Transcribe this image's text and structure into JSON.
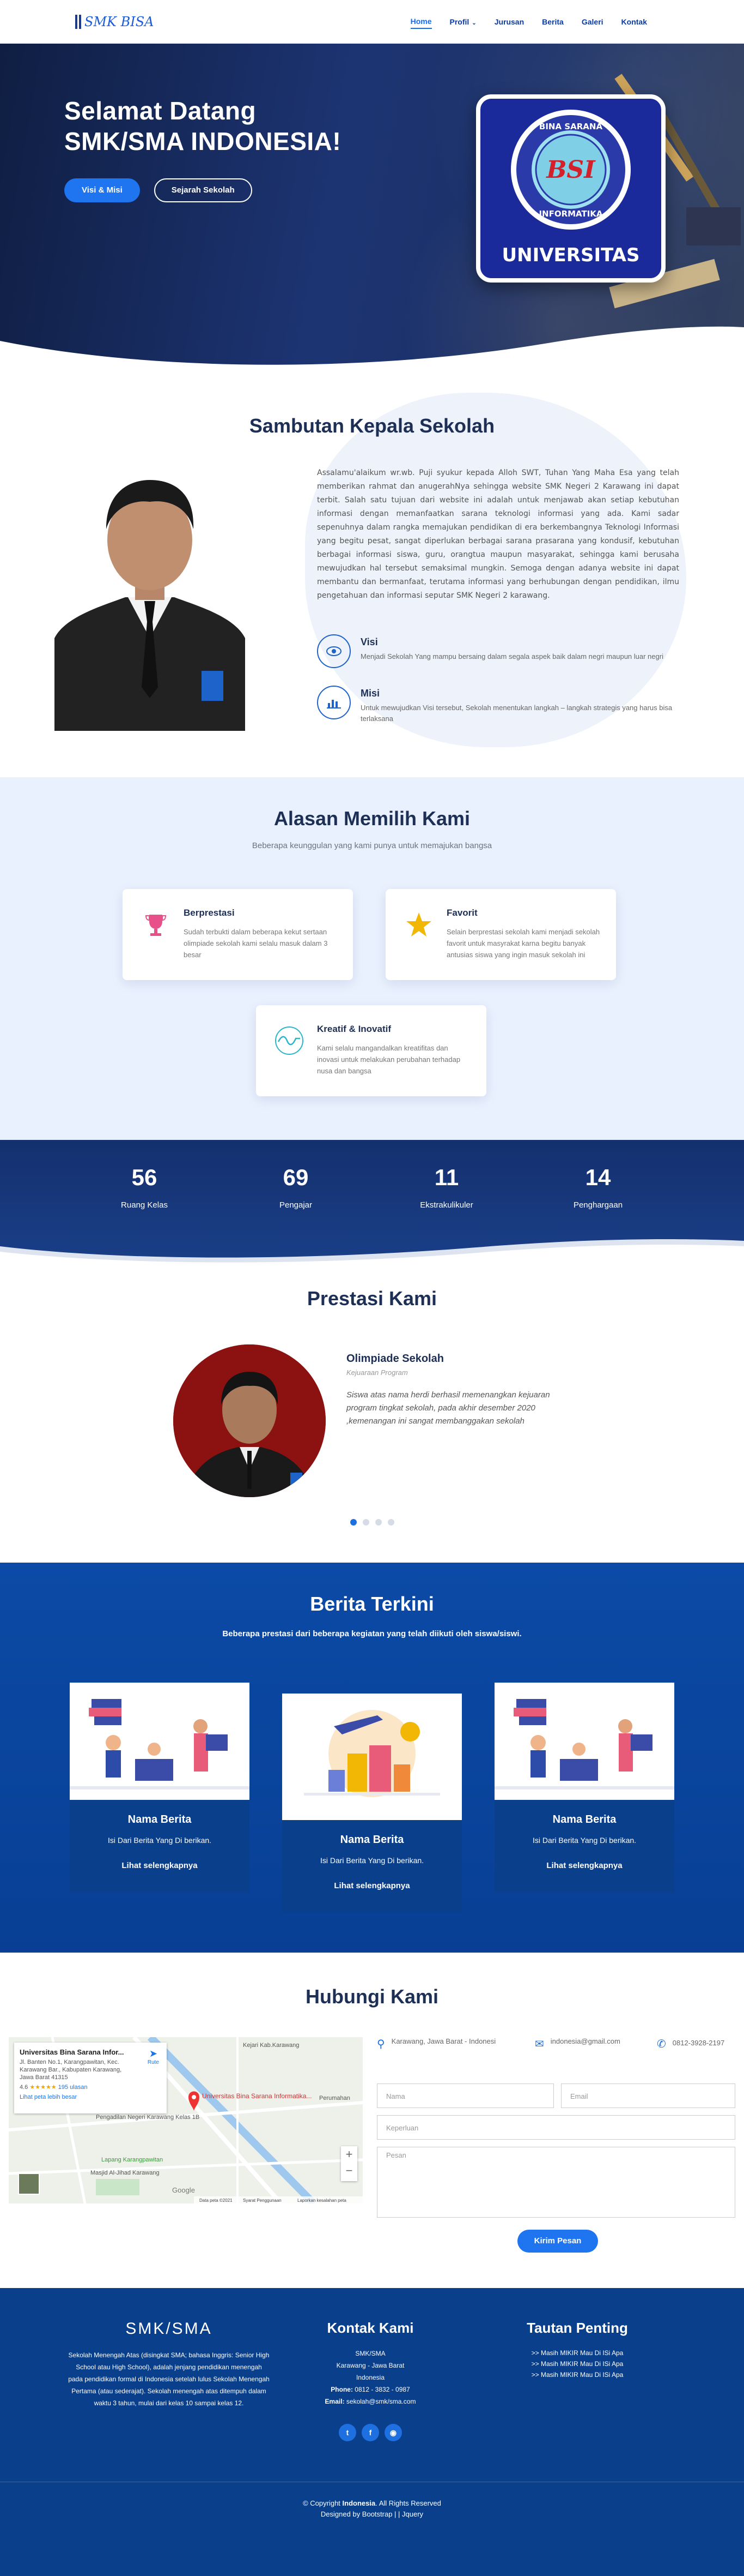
{
  "brand": {
    "logo_text": "SMK BISA"
  },
  "nav": {
    "home": "Home",
    "profil": "Profil",
    "jurusan": "Jurusan",
    "berita": "Berita",
    "galeri": "Galeri",
    "kontak": "Kontak"
  },
  "hero": {
    "title_line1": "Selamat Datang",
    "title_line2": "SMK/SMA INDONESIA!",
    "btn_primary": "Visi & Misi",
    "btn_secondary": "Sejarah Sekolah",
    "badge_top": "BINA SARANA",
    "badge_mid": "BSI",
    "badge_bottom": "INFORMATIKA",
    "badge_label": "UNIVERSITAS"
  },
  "sambutan": {
    "title": "Sambutan Kepala Sekolah",
    "text": "Assalamu'alaikum wr.wb. Puji syukur kepada Alloh SWT, Tuhan Yang Maha Esa yang telah memberikan rahmat dan anugerahNya sehingga website SMK Negeri 2 Karawang ini dapat terbit. Salah satu tujuan dari website ini adalah untuk menjawab akan setiap kebutuhan informasi dengan memanfaatkan sarana teknologi informasi yang ada. Kami sadar sepenuhnya dalam rangka memajukan pendidikan di era berkembangnya Teknologi Informasi yang begitu pesat, sangat diperlukan berbagai sarana prasarana yang kondusif, kebutuhan berbagai informasi siswa, guru, orangtua maupun masyarakat, sehingga kami berusaha mewujudkan hal tersebut semaksimal mungkin. Semoga dengan adanya website ini dapat membantu dan bermanfaat, terutama informasi yang berhubungan dengan pendidikan, ilmu pengetahuan dan informasi seputar SMK Negeri 2 karawang.",
    "visi_title": "Visi",
    "visi_text": "Menjadi Sekolah Yang mampu bersaing dalam segala aspek baik dalam negri maupun luar negri",
    "misi_title": "Misi",
    "misi_text": "Untuk mewujudkan Visi tersebut, Sekolah menentukan langkah – langkah strategis yang harus bisa terlaksana"
  },
  "alasan": {
    "title": "Alasan Memilih Kami",
    "subtitle": "Beberapa keunggulan yang kami punya untuk memajukan bangsa",
    "cards": [
      {
        "title": "Berprestasi",
        "text": "Sudah terbukti dalam beberapa kekut sertaan olimpiade sekolah kami selalu masuk dalam 3 besar",
        "icon": "trophy-icon",
        "color": "#e8508a"
      },
      {
        "title": "Favorit",
        "text": "Selain berprestasi sekolah kami menjadi sekolah favorit untuk masyrakat karna begitu banyak antusias siswa yang ingin masuk sekolah ini",
        "icon": "star-icon",
        "color": "#f2b705"
      },
      {
        "title": "Kreatif & Inovatif",
        "text": "Kami selalu mangandalkan kreatifitas dan inovasi untuk melakukan perubahan terhadap nusa dan bangsa",
        "icon": "pulse-icon",
        "color": "#2bb5c8"
      }
    ]
  },
  "stats": [
    {
      "num": "56",
      "label": "Ruang Kelas"
    },
    {
      "num": "69",
      "label": "Pengajar"
    },
    {
      "num": "11",
      "label": "Ekstrakulikuler"
    },
    {
      "num": "14",
      "label": "Penghargaan"
    }
  ],
  "prestasi": {
    "title": "Prestasi Kami",
    "name": "Olimpiade Sekolah",
    "sub": "Kejuaraan Program",
    "text": "Siswa atas nama herdi berhasil memenangkan kejuaran program tingkat sekolah, pada akhir desember 2020 ,kemenangan ini sangat membanggakan sekolah"
  },
  "berita": {
    "title": "Berita Terkini",
    "subtitle": "Beberapa prestasi dari beberapa kegiatan yang telah diikuti oleh siswa/siswi.",
    "items": [
      {
        "title": "Nama Berita",
        "text": "Isi Dari Berita Yang Di berikan.",
        "link": "Lihat selengkapnya"
      },
      {
        "title": "Nama Berita",
        "text": "Isi Dari Berita Yang Di berikan.",
        "link": "Lihat selengkapnya"
      },
      {
        "title": "Nama Berita",
        "text": "Isi Dari Berita Yang Di berikan.",
        "link": "Lihat selengkapnya"
      }
    ]
  },
  "hubungi": {
    "title": "Hubungi Kami",
    "address": "Karawang, Jawa Barat - Indonesi",
    "email": "indonesia@gmail.com",
    "phone": "0812-3928-2197",
    "map": {
      "place_title": "Universitas Bina Sarana Infor...",
      "place_addr": "Jl. Banten No.1, Karangpawitan, Kec. Karawang Bar., Kabupaten Karawang, Jawa Barat 41315",
      "rating": "4.6",
      "reviews": "195 ulasan",
      "bigger": "Lihat peta lebih besar",
      "route": "Rute",
      "pin_label": "Universitas Bina Sarana Informatika...",
      "l1": "Pengadilan Negeri Karawang Kelas 1B",
      "l2": "Lapang Karangpawitan",
      "l3": "Masjid Al-Jihad Karawang",
      "l4": "Perumahan",
      "l5": "Kejari Kab.Karawang",
      "footer_data": "Data peta ©2021",
      "footer_terms": "Syarat Penggunaan",
      "footer_report": "Laporkan kesalahan peta",
      "google": "Google"
    },
    "ph_nama": "Nama",
    "ph_email": "Email",
    "ph_keperluan": "Keperluan",
    "ph_pesan": "Pesan",
    "btn": "Kirim Pesan"
  },
  "footer": {
    "brand": "SMK/SMA",
    "about": "Sekolah Menengah Atas (disingkat SMA; bahasa Inggris: Senior High School atau High School), adalah jenjang pendidikan menengah pada pendidikan formal di Indonesia setelah lulus Sekolah Menengah Pertama (atau sederajat). Sekolah menengah atas ditempuh dalam waktu 3 tahun, mulai dari kelas 10 sampai kelas 12.",
    "contact_title": "Kontak Kami",
    "c1": "SMK/SMA",
    "c2": "Karawang - Jawa Barat",
    "c3": "Indonesia",
    "phone_label": "Phone:",
    "phone": "0812 - 3832 - 0987",
    "email_label": "Email:",
    "email": "sekolah@smk/sma.com",
    "links_title": "Tautan Penting",
    "links": [
      ">> Masih MIKIR Mau Di ISi Apa",
      ">> Masih MIKIR Mau Di ISi Apa",
      ">> Masih MIKIR Mau Di ISi Apa"
    ],
    "copy_pre": "© Copyright ",
    "copy_brand": "Indonesia",
    "copy_post": ". All Rights Reserved",
    "designed": "Designed by Bootstrap | | Jquery"
  }
}
